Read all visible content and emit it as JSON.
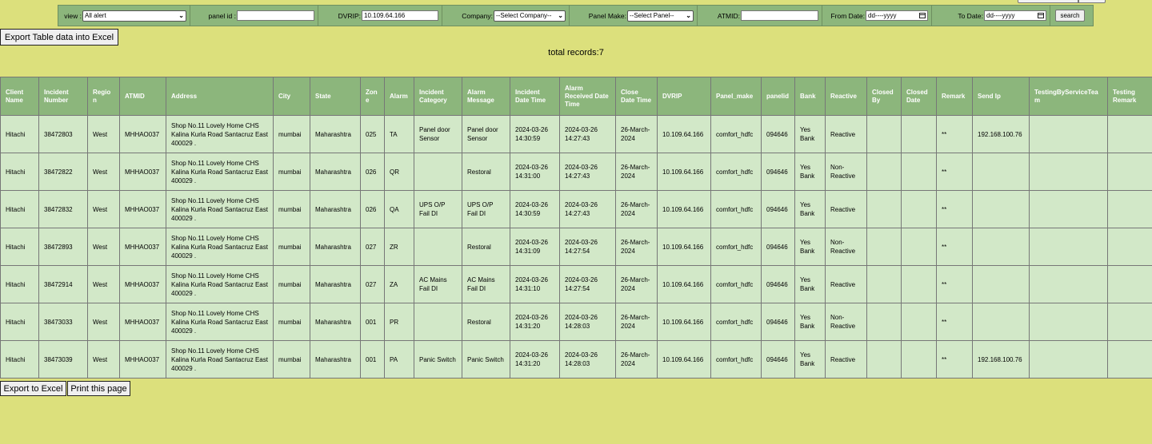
{
  "filters": {
    "view_label": "view :",
    "view_value": "All alert",
    "panel_id_label": "panel id :",
    "panel_id_value": "",
    "dvrip_label": "DVRIP:",
    "dvrip_value": "10.109.64.166",
    "company_label": "Company:",
    "company_value": "--Select Company--",
    "panel_make_label": "Panel Make:",
    "panel_make_value": "--Select Panel--",
    "atmid_label": "ATMID:",
    "atmid_value": "",
    "from_date_label": "From Date:",
    "from_date_value": "dd----yyyy",
    "to_date_label": "To Date:",
    "to_date_value": "dd----yyyy",
    "search_label": "search"
  },
  "export_table_label": "Export Table data into Excel",
  "total_records": "total records:7",
  "columns": [
    "Client Name",
    "Incident Number",
    "Region",
    "ATMID",
    "Address",
    "City",
    "State",
    "Zone",
    "Alarm",
    "Incident Category",
    "Alarm Message",
    "Incident Date Time",
    "Alarm Received Date Time",
    "Close Date Time",
    "DVRIP",
    "Panel_make",
    "panelid",
    "Bank",
    "Reactive",
    "Closed By",
    "Closed Date",
    "Remark",
    "Send Ip",
    "TestingByServiceTeam",
    "Testing Remark"
  ],
  "rows": [
    [
      "Hitachi",
      "38472803",
      "West",
      "MHHAO037",
      "Shop No.11 Lovely Home CHS Kalina Kurla Road Santacruz East 400029 .",
      "mumbai",
      "Maharashtra",
      "025",
      "TA",
      "Panel door Sensor",
      "Panel door Sensor",
      "2024-03-26 14:30:59",
      "2024-03-26 14:27:43",
      "26-March-2024",
      "10.109.64.166",
      "comfort_hdfc",
      "094646",
      "Yes Bank",
      "Reactive",
      "",
      "",
      "**",
      "192.168.100.76",
      "",
      ""
    ],
    [
      "Hitachi",
      "38472822",
      "West",
      "MHHAO037",
      "Shop No.11 Lovely Home CHS Kalina Kurla Road Santacruz East 400029 .",
      "mumbai",
      "Maharashtra",
      "026",
      "QR",
      "",
      "Restoral",
      "2024-03-26 14:31:00",
      "2024-03-26 14:27:43",
      "26-March-2024",
      "10.109.64.166",
      "comfort_hdfc",
      "094646",
      "Yes Bank",
      "Non-Reactive",
      "",
      "",
      "**",
      "",
      "",
      ""
    ],
    [
      "Hitachi",
      "38472832",
      "West",
      "MHHAO037",
      "Shop No.11 Lovely Home CHS Kalina Kurla Road Santacruz East 400029 .",
      "mumbai",
      "Maharashtra",
      "026",
      "QA",
      "UPS O/P Fail DI",
      "UPS O/P Fail DI",
      "2024-03-26 14:30:59",
      "2024-03-26 14:27:43",
      "26-March-2024",
      "10.109.64.166",
      "comfort_hdfc",
      "094646",
      "Yes Bank",
      "Reactive",
      "",
      "",
      "**",
      "",
      "",
      ""
    ],
    [
      "Hitachi",
      "38472893",
      "West",
      "MHHAO037",
      "Shop No.11 Lovely Home CHS Kalina Kurla Road Santacruz East 400029 .",
      "mumbai",
      "Maharashtra",
      "027",
      "ZR",
      "",
      "Restoral",
      "2024-03-26 14:31:09",
      "2024-03-26 14:27:54",
      "26-March-2024",
      "10.109.64.166",
      "comfort_hdfc",
      "094646",
      "Yes Bank",
      "Non-Reactive",
      "",
      "",
      "**",
      "",
      "",
      ""
    ],
    [
      "Hitachi",
      "38472914",
      "West",
      "MHHAO037",
      "Shop No.11 Lovely Home CHS Kalina Kurla Road Santacruz East 400029 .",
      "mumbai",
      "Maharashtra",
      "027",
      "ZA",
      "AC Mains Fail DI",
      "AC Mains Fail DI",
      "2024-03-26 14:31:10",
      "2024-03-26 14:27:54",
      "26-March-2024",
      "10.109.64.166",
      "comfort_hdfc",
      "094646",
      "Yes Bank",
      "Reactive",
      "",
      "",
      "**",
      "",
      "",
      ""
    ],
    [
      "Hitachi",
      "38473033",
      "West",
      "MHHAO037",
      "Shop No.11 Lovely Home CHS Kalina Kurla Road Santacruz East 400029 .",
      "mumbai",
      "Maharashtra",
      "001",
      "PR",
      "",
      "Restoral",
      "2024-03-26 14:31:20",
      "2024-03-26 14:28:03",
      "26-March-2024",
      "10.109.64.166",
      "comfort_hdfc",
      "094646",
      "Yes Bank",
      "Non-Reactive",
      "",
      "",
      "**",
      "",
      "",
      ""
    ],
    [
      "Hitachi",
      "38473039",
      "West",
      "MHHAO037",
      "Shop No.11 Lovely Home CHS Kalina Kurla Road Santacruz East 400029 .",
      "mumbai",
      "Maharashtra",
      "001",
      "PA",
      "Panic Switch",
      "Panic Switch",
      "2024-03-26 14:31:20",
      "2024-03-26 14:28:03",
      "26-March-2024",
      "10.109.64.166",
      "comfort_hdfc",
      "094646",
      "Yes Bank",
      "Reactive",
      "",
      "",
      "**",
      "192.168.100.76",
      "",
      ""
    ]
  ],
  "footer": {
    "export_excel_label": "Export to Excel",
    "print_label": "Print this page"
  }
}
